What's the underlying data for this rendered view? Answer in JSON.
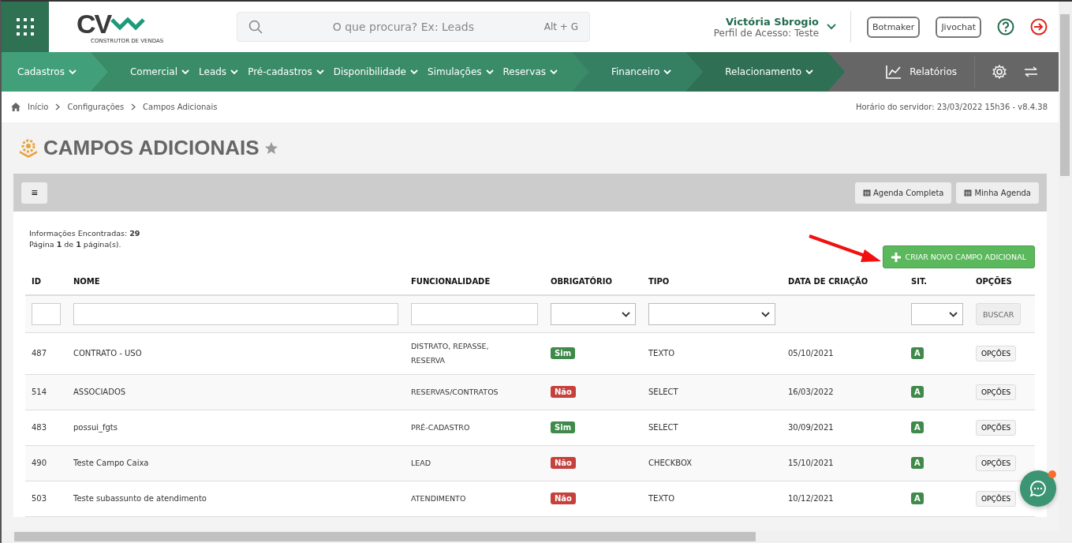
{
  "header": {
    "logo_text": "CV",
    "logo_tagline": "CONSTRUTOR DE VENDAS",
    "search": {
      "placeholder": "O que procura? Ex: Leads",
      "shortcut": "Alt + G"
    },
    "user": {
      "name": "Victória Sbrogio",
      "profile": "Perfil de Acesso: Teste"
    },
    "buttons": [
      "Botmaker",
      "Jivochat"
    ]
  },
  "nav": {
    "segments": [
      {
        "items": [
          "Cadastros"
        ]
      },
      {
        "items": [
          "Comercial",
          "Leads",
          "Pré-cadastros",
          "Disponibilidade",
          "Simulações",
          "Reservas"
        ]
      },
      {
        "items": [
          "Financeiro"
        ]
      },
      {
        "items": [
          "Relacionamento"
        ]
      }
    ],
    "reports": "Relatórios"
  },
  "breadcrumb": [
    "Início",
    "Configurações",
    "Campos Adicionais"
  ],
  "server_time": "Horário do servidor: 23/03/2022 15h36 - v8.4.38",
  "page_title": "CAMPOS ADICIONAIS",
  "toolbar": {
    "menu_glyph": "≡",
    "buttons": [
      "Agenda Completa",
      "Minha Agenda"
    ]
  },
  "summary": [
    "Informações Encontradas: **29**",
    "Página **1** de **1** página(s)."
  ],
  "create_button": "CRIAR NOVO CAMPO ADICIONAL",
  "table": {
    "columns": [
      "ID",
      "NOME",
      "FUNCIONALIDADE",
      "OBRIGATÓRIO",
      "TIPO",
      "DATA DE CRIAÇÃO",
      "SIT.",
      "OPÇÕES"
    ],
    "filters": [
      {
        "kind": "text"
      },
      {
        "kind": "text"
      },
      {
        "kind": "text"
      },
      {
        "kind": "select"
      },
      {
        "kind": "select"
      },
      {
        "kind": "none"
      },
      {
        "kind": "select"
      },
      {
        "kind": "button",
        "label": "BUSCAR"
      }
    ],
    "rows": [
      {
        "id": "487",
        "name": "CONTRATO - USO",
        "feature": "DISTRATO, REPASSE, RESERVA",
        "required": true,
        "required_label": "Sim",
        "type": "TEXTO",
        "created": "05/10/2021",
        "status": "A",
        "options": "OPÇÕES"
      },
      {
        "id": "514",
        "name": "ASSOCIADOS",
        "feature": "RESERVAS/CONTRATOS",
        "required": false,
        "required_label": "Não",
        "type": "SELECT",
        "created": "16/03/2022",
        "status": "A",
        "options": "OPÇÕES"
      },
      {
        "id": "483",
        "name": "possui_fgts",
        "feature": "PRÉ-CADASTRO",
        "required": true,
        "required_label": "Sim",
        "type": "SELECT",
        "created": "30/09/2021",
        "status": "A",
        "options": "OPÇÕES"
      },
      {
        "id": "490",
        "name": "Teste Campo Caixa",
        "feature": "LEAD",
        "required": false,
        "required_label": "Não",
        "type": "CHECKBOX",
        "created": "15/10/2021",
        "status": "A",
        "options": "OPÇÕES"
      },
      {
        "id": "503",
        "name": "Teste subassunto de atendimento",
        "feature": "ATENDIMENTO",
        "required": false,
        "required_label": "Não",
        "type": "TEXTO",
        "created": "10/12/2021",
        "status": "A",
        "options": "OPÇÕES"
      }
    ]
  },
  "chat": {
    "unread": true
  }
}
